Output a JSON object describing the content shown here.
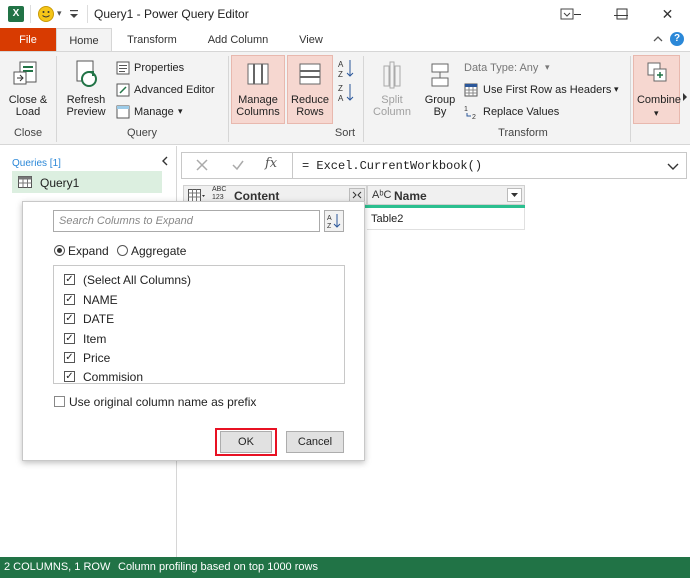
{
  "titlebar": {
    "title": "Query1 - Power Query Editor",
    "qat_dropdown": "▾",
    "minimize": "—",
    "maximize": "☐",
    "close": "✕"
  },
  "tabs": {
    "file": "File",
    "home": "Home",
    "transform": "Transform",
    "add_column": "Add Column",
    "view": "View"
  },
  "ribbon": {
    "close_load": "Close &\nLoad",
    "close_load_arrow": "▾",
    "group_close": "Close",
    "refresh_preview": "Refresh\nPreview",
    "properties": "Properties",
    "advanced_editor": "Advanced Editor",
    "manage": "Manage",
    "group_query": "Query",
    "manage_columns": "Manage\nColumns",
    "reduce_rows": "Reduce\nRows",
    "group_sort": "Sort",
    "split_column": "Split\nColumn",
    "group_by": "Group\nBy",
    "data_type": "Data Type: Any",
    "first_row_headers": "Use First Row as Headers",
    "replace_values": "Replace Values",
    "group_transform": "Transform",
    "combine": "Combine"
  },
  "leftpane": {
    "queries_label": "Queries [1]",
    "query_item": "Query1"
  },
  "formula": {
    "text": "= Excel.CurrentWorkbook()",
    "fx": "fx"
  },
  "grid": {
    "col1_type": "ABC\n123",
    "col1_name": "Content",
    "col2_type": "AᵇC",
    "col2_name": "Name",
    "cell_name": "Table2"
  },
  "dialog": {
    "search_placeholder": "Search Columns to Expand",
    "expand": "Expand",
    "aggregate": "Aggregate",
    "columns": [
      "(Select All Columns)",
      "NAME",
      "DATE",
      "Item",
      "Price",
      "Commision"
    ],
    "prefix_label": "Use original column name as prefix",
    "ok": "OK",
    "cancel": "Cancel"
  },
  "status": {
    "left": "2 COLUMNS, 1 ROW",
    "right": "Column profiling based on top 1000 rows"
  },
  "colors": {
    "excel_green": "#217346",
    "file_tab": "#d83b01",
    "highlight_red": "#e81123",
    "query_selected": "#dcefe0"
  }
}
